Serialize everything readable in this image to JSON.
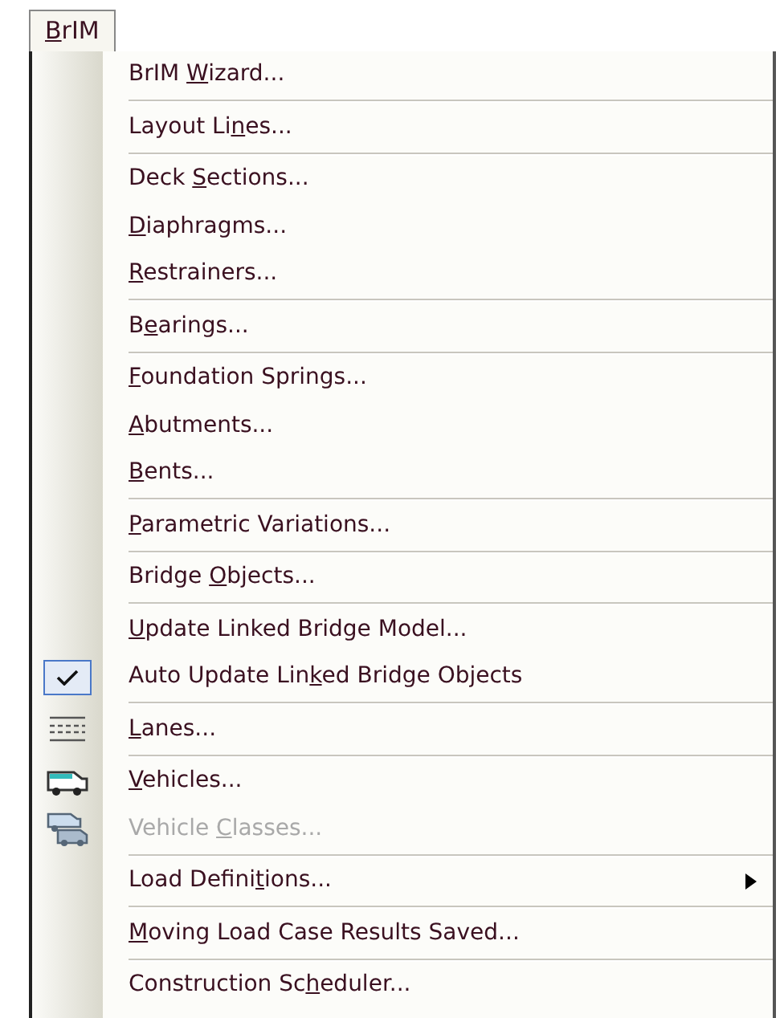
{
  "menu_title": {
    "label": {
      "key": "B",
      "post": "rIM"
    }
  },
  "items": [
    {
      "kind": "item",
      "label": {
        "pre": "BrIM ",
        "key": "W",
        "post": "izard..."
      }
    },
    {
      "kind": "separator"
    },
    {
      "kind": "item",
      "label": {
        "pre": "Layout Li",
        "key": "n",
        "post": "es..."
      }
    },
    {
      "kind": "separator"
    },
    {
      "kind": "item",
      "label": {
        "pre": "Deck ",
        "key": "S",
        "post": "ections..."
      }
    },
    {
      "kind": "item",
      "label": {
        "key": "D",
        "post": "iaphragms..."
      }
    },
    {
      "kind": "item",
      "label": {
        "key": "R",
        "post": "estrainers..."
      }
    },
    {
      "kind": "separator"
    },
    {
      "kind": "item",
      "label": {
        "pre": "B",
        "key": "e",
        "post": "arings..."
      }
    },
    {
      "kind": "separator"
    },
    {
      "kind": "item",
      "label": {
        "key": "F",
        "post": "oundation Springs..."
      }
    },
    {
      "kind": "item",
      "label": {
        "key": "A",
        "post": "butments..."
      }
    },
    {
      "kind": "item",
      "label": {
        "key": "B",
        "post": "ents..."
      }
    },
    {
      "kind": "separator"
    },
    {
      "kind": "item",
      "label": {
        "key": "P",
        "post": "arametric Variations..."
      }
    },
    {
      "kind": "separator"
    },
    {
      "kind": "item",
      "label": {
        "pre": "Bridge ",
        "key": "O",
        "post": "bjects..."
      }
    },
    {
      "kind": "separator"
    },
    {
      "kind": "item",
      "label": {
        "key": "U",
        "post": "pdate Linked Bridge Model..."
      }
    },
    {
      "kind": "item",
      "label": {
        "pre": "Auto Update Lin",
        "key": "k",
        "post": "ed Bridge Objects"
      },
      "checked": true
    },
    {
      "kind": "separator"
    },
    {
      "kind": "lanes",
      "label": {
        "key": "L",
        "post": "anes..."
      }
    },
    {
      "kind": "separator"
    },
    {
      "kind": "vehicle",
      "label": {
        "key": "V",
        "post": "ehicles..."
      }
    },
    {
      "kind": "vehicle-classes",
      "label": {
        "pre": "Vehicle ",
        "key": "C",
        "post": "lasses..."
      },
      "disabled": true
    },
    {
      "kind": "separator"
    },
    {
      "kind": "item",
      "label": {
        "pre": "Load Defini",
        "key": "t",
        "post": "ions..."
      },
      "submenu": true
    },
    {
      "kind": "separator"
    },
    {
      "kind": "item",
      "label": {
        "key": "M",
        "post": "oving Load Case Results Saved..."
      }
    },
    {
      "kind": "separator"
    },
    {
      "kind": "item",
      "label": {
        "pre": "Construction Sc",
        "key": "h",
        "post": "eduler..."
      }
    }
  ]
}
